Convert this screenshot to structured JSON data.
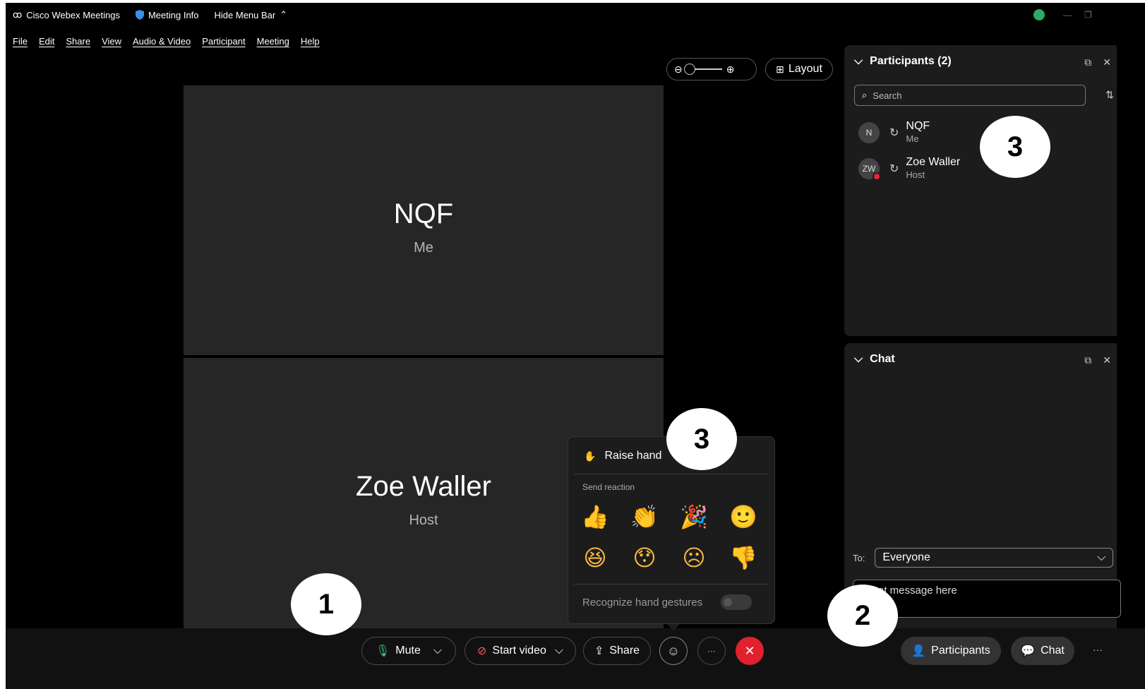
{
  "titlebar": {
    "app_title": "Cisco Webex Meetings",
    "meeting_info": "Meeting Info",
    "hide_menu": "Hide Menu Bar"
  },
  "menu": [
    "File",
    "Edit",
    "Share",
    "View",
    "Audio & Video",
    "Participant",
    "Meeting",
    "Help"
  ],
  "top_controls": {
    "layout_label": "Layout"
  },
  "videos": [
    {
      "name": "NQF",
      "role": "Me"
    },
    {
      "name": "Zoe Waller",
      "role": "Host"
    }
  ],
  "participants_panel": {
    "title": "Participants (2)",
    "search_placeholder": "Search",
    "items": [
      {
        "initials": "N",
        "name": "NQF",
        "role": "Me"
      },
      {
        "initials": "ZW",
        "name": "Zoe Waller",
        "role": "Host"
      }
    ]
  },
  "chat_panel": {
    "title": "Chat",
    "to_label": "To:",
    "to_value": "Everyone",
    "input_text": "r chat message here"
  },
  "reactions": {
    "raise_hand": "Raise hand",
    "send_reaction": "Send reaction",
    "emojis": [
      "👍",
      "👏",
      "🎉",
      "🙂",
      "😆",
      "😯",
      "☹",
      "👎"
    ],
    "hand_gestures": "Recognize hand gestures",
    "hand_gestures_enabled": false
  },
  "toolbar": {
    "mute": "Mute",
    "start_video": "Start video",
    "share": "Share",
    "more": "···",
    "participants": "Participants",
    "chat": "Chat"
  },
  "callouts": [
    "1",
    "2",
    "3",
    "3"
  ],
  "colors": {
    "end_call": "#e0212e",
    "panel_bg": "#1c1c1c",
    "tile_bg": "#262626"
  }
}
